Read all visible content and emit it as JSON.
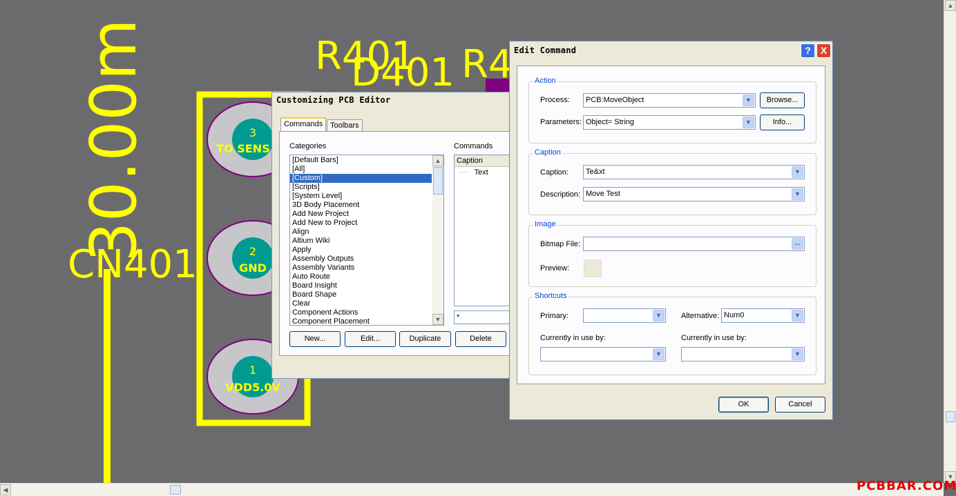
{
  "pcb": {
    "designators": [
      "R401",
      "D401",
      "R4",
      "CN401"
    ],
    "dimension": "30.00m",
    "pads": [
      {
        "number": "3",
        "net": "TO SENS"
      },
      {
        "number": "2",
        "net": "GND"
      },
      {
        "number": "1",
        "net": "VDD5.0V"
      }
    ],
    "colors": {
      "silkscreen": "#ffff00",
      "pad": "#c7c7c9",
      "padHole": "#009a93",
      "keepout": "#800080",
      "background": "#6b6b6d"
    }
  },
  "watermark": "PCBBAR.COM",
  "customize": {
    "title": "Customizing PCB Editor",
    "tabs": [
      "Commands",
      "Toolbars"
    ],
    "categories_label": "Categories",
    "commands_label": "Commands",
    "categories": [
      "[Default Bars]",
      "[All]",
      "[Custom]",
      "[Scripts]",
      "[System Level]",
      "3D Body Placement",
      "Add New Project",
      "Add New to Project",
      "Align",
      "Altium Wiki",
      "Apply",
      "Assembly Outputs",
      "Assembly Variants",
      "Auto Route",
      "Board Insight",
      "Board Shape",
      "Clear",
      "Component Actions",
      "Component Placement"
    ],
    "selected_category": "[Custom]",
    "commands_header": "Caption",
    "commands_item": "Text",
    "filter_value": "*",
    "buttons": {
      "new": "New...",
      "edit": "Edit...",
      "duplicate": "Duplicate",
      "delete": "Delete"
    }
  },
  "edit": {
    "title": "Edit Command",
    "help_icon": "?",
    "close_icon": "X",
    "action": {
      "group": "Action",
      "process_label": "Process:",
      "process_value": "PCB:MoveObject",
      "browse": "Browse...",
      "parameters_label": "Parameters:",
      "parameters_value": "Object= String",
      "info": "Info..."
    },
    "caption": {
      "group": "Caption",
      "caption_label": "Caption:",
      "caption_value": "Te&xt",
      "description_label": "Description:",
      "description_value": "Move Test"
    },
    "image": {
      "group": "Image",
      "bitmap_label": "Bitmap File:",
      "bitmap_value": "",
      "ellipsis": "...",
      "preview_label": "Preview:"
    },
    "shortcuts": {
      "group": "Shortcuts",
      "primary_label": "Primary:",
      "primary_value": "",
      "alternative_label": "Alternative:",
      "alternative_value": "Num0",
      "inuse_primary_label": "Currently in use by:",
      "inuse_primary_value": "",
      "inuse_alt_label": "Currently in use by:",
      "inuse_alt_value": ""
    },
    "ok": "OK",
    "cancel": "Cancel"
  }
}
